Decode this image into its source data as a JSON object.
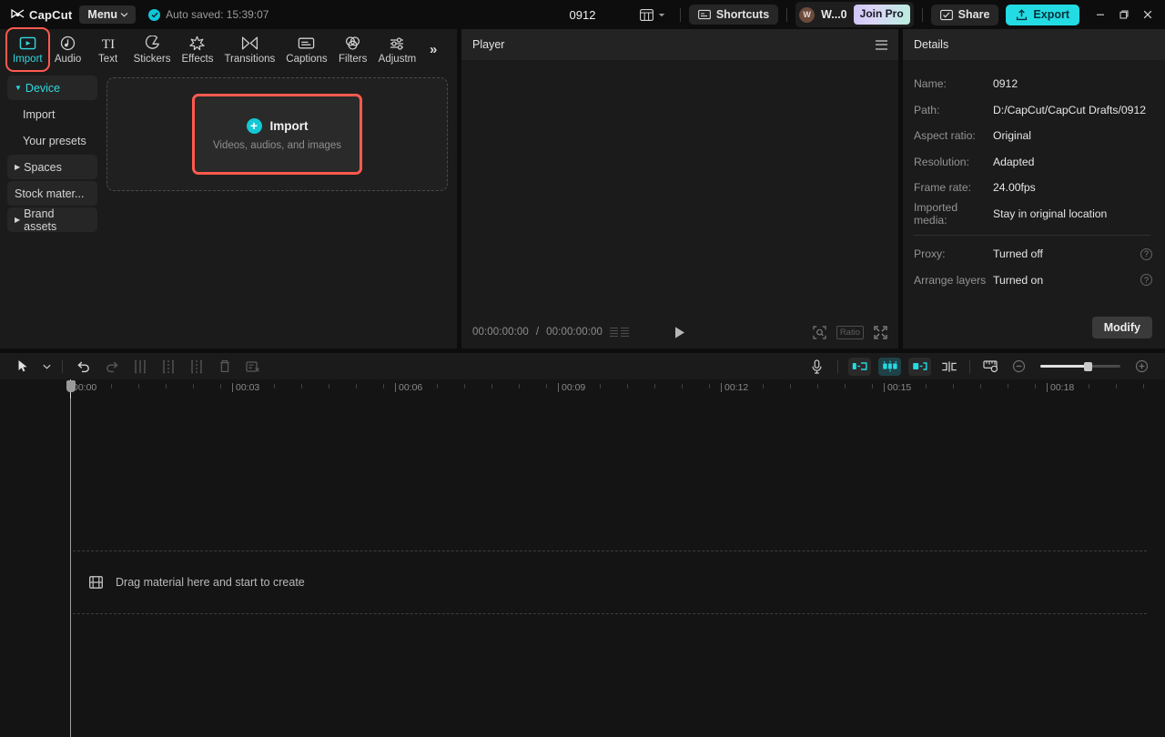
{
  "titlebar": {
    "brand": "CapCut",
    "menu_label": "Menu",
    "autosave": "Auto saved: 15:39:07",
    "project_title": "0912",
    "layout_icon": "layout-grid-icon",
    "shortcuts_label": "Shortcuts",
    "user_initial": "W",
    "user_name": "W...0",
    "join_pro_label": "Join Pro",
    "share_label": "Share",
    "export_label": "Export",
    "minimize": "minimize-icon",
    "maximize": "restore-icon",
    "close": "close-icon"
  },
  "library": {
    "tabs": [
      {
        "label": "Import",
        "icon": "media-import-icon",
        "active": true,
        "highlight": true
      },
      {
        "label": "Audio",
        "icon": "audio-note-icon",
        "active": false,
        "highlight": false
      },
      {
        "label": "Text",
        "icon": "text-ti-icon",
        "active": false,
        "highlight": false
      },
      {
        "label": "Stickers",
        "icon": "sticker-icon",
        "active": false,
        "highlight": false
      },
      {
        "label": "Effects",
        "icon": "effects-sparkle-icon",
        "active": false,
        "highlight": false
      },
      {
        "label": "Transitions",
        "icon": "transitions-icon",
        "active": false,
        "highlight": false
      },
      {
        "label": "Captions",
        "icon": "captions-icon",
        "active": false,
        "highlight": false
      },
      {
        "label": "Filters",
        "icon": "filters-circles-icon",
        "active": false,
        "highlight": false
      },
      {
        "label": "Adjustm",
        "icon": "adjustment-sliders-icon",
        "active": false,
        "highlight": false
      }
    ],
    "more_tabs": "»",
    "nav": [
      {
        "label": "Device",
        "type": "group",
        "selected": true,
        "expanded": true
      },
      {
        "label": "Import",
        "type": "sub",
        "selected": false
      },
      {
        "label": "Your presets",
        "type": "sub",
        "selected": false
      },
      {
        "label": "Spaces",
        "type": "group",
        "selected": false,
        "expanded": false
      },
      {
        "label": "Stock mater...",
        "type": "plain",
        "selected": false
      },
      {
        "label": "Brand assets",
        "type": "group",
        "selected": false,
        "expanded": false
      }
    ],
    "import_card": {
      "title": "Import",
      "subtitle": "Videos, audios, and images",
      "plus_icon": "plus-circle-icon"
    }
  },
  "player": {
    "title": "Player",
    "menu_icon": "hamburger-icon",
    "current_time": "00:00:00:00",
    "total_time": "00:00:00:00",
    "time_separator": "/",
    "play_icon": "play-icon",
    "zoom_icon": "zoom-fit-icon",
    "ratio_label": "Ratio",
    "fullscreen_icon": "fullscreen-icon"
  },
  "details": {
    "title": "Details",
    "rows": [
      {
        "key": "Name:",
        "value": "0912",
        "help": false
      },
      {
        "key": "Path:",
        "value": "D:/CapCut/CapCut Drafts/0912",
        "help": false
      },
      {
        "key": "Aspect ratio:",
        "value": "Original",
        "help": false
      },
      {
        "key": "Resolution:",
        "value": "Adapted",
        "help": false
      },
      {
        "key": "Frame rate:",
        "value": "24.00fps",
        "help": false
      },
      {
        "key": "Imported media:",
        "value": "Stay in original location",
        "help": false
      }
    ],
    "rows2": [
      {
        "key": "Proxy:",
        "value": "Turned off",
        "help": true
      },
      {
        "key": "Arrange layers",
        "value": "Turned on",
        "help": true
      }
    ],
    "help_glyph": "?",
    "modify_label": "Modify"
  },
  "timeline": {
    "tools_left": [
      {
        "name": "select-cursor-icon",
        "dim": false
      },
      {
        "name": "cursor-dropdown-icon",
        "dim": false
      },
      {
        "name": "undo-icon",
        "dim": false
      },
      {
        "name": "redo-icon",
        "dim": true
      },
      {
        "name": "split-icon",
        "dim": true
      },
      {
        "name": "trim-left-icon",
        "dim": true
      },
      {
        "name": "trim-right-icon",
        "dim": true
      },
      {
        "name": "delete-icon",
        "dim": true
      },
      {
        "name": "clear-icon",
        "dim": true
      }
    ],
    "tools_right": [
      {
        "name": "microphone-icon",
        "active": false
      },
      {
        "name": "clip-start-icon",
        "active": false
      },
      {
        "name": "clip-mid-icon",
        "active": true
      },
      {
        "name": "clip-end-icon",
        "active": false
      },
      {
        "name": "split-marker-icon",
        "active": false
      },
      {
        "name": "measure-ruler-icon",
        "active": false
      }
    ],
    "zoom_out_icon": "zoom-out-icon",
    "zoom_in_icon": "zoom-in-icon",
    "ruler_labels": [
      "00:00",
      "00:03",
      "00:06",
      "00:09",
      "00:12",
      "00:15",
      "00:18"
    ],
    "drop_hint": "Drag material here and start to create",
    "drop_icon": "film-strip-icon"
  },
  "colors": {
    "accent_teal": "#23dbe3",
    "highlight_red": "#ff5a4e",
    "panel_bg": "#1b1b1b",
    "app_bg": "#0d0d0d",
    "timeline_bg": "#141414"
  }
}
